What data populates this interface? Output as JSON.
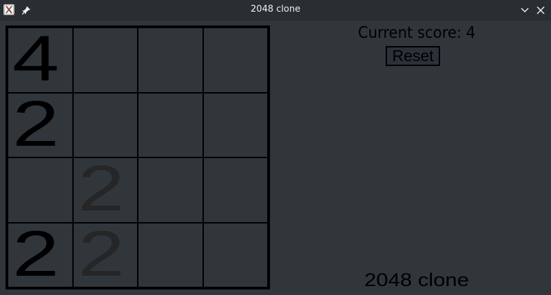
{
  "window": {
    "title": "2048 clone",
    "icons": {
      "app": "app-icon",
      "pin": "pin-icon",
      "minimize": "chevron-down-icon",
      "close": "close-icon"
    }
  },
  "scoreboard": {
    "current_score_label": "Current score: 4"
  },
  "controls": {
    "reset_label": "Reset"
  },
  "footer": {
    "title": "2048 clone"
  },
  "board": {
    "rows": [
      [
        "4",
        "",
        "",
        ""
      ],
      [
        "2",
        "",
        "",
        ""
      ],
      [
        "",
        "2",
        "",
        ""
      ],
      [
        "2",
        "2",
        "",
        ""
      ]
    ]
  },
  "colors": {
    "background": "#31363b",
    "titlebar": "#2a2e32",
    "grid_lines": "#000000",
    "tile_text": "#000000",
    "tile_text_new": "#262626"
  }
}
